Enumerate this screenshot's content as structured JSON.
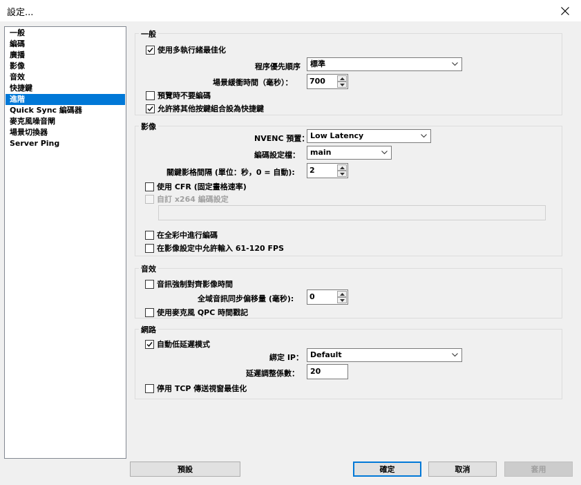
{
  "window": {
    "title": "設定..."
  },
  "sidebar": {
    "items": [
      {
        "label": "一般"
      },
      {
        "label": "編碼"
      },
      {
        "label": "廣播"
      },
      {
        "label": "影像"
      },
      {
        "label": "音效"
      },
      {
        "label": "快捷鍵"
      },
      {
        "label": "進階",
        "selected": true
      },
      {
        "label": "Quick Sync 編碼器"
      },
      {
        "label": "麥克風噪音閘"
      },
      {
        "label": "場景切換器"
      },
      {
        "label": "Server Ping"
      }
    ]
  },
  "general": {
    "title": "一般",
    "multithread_label": "使用多執行緒最佳化",
    "multithread_checked": true,
    "priority_label": "程序優先順序",
    "priority_value": "標準",
    "scene_buffer_label": "場景緩衝時間（毫秒）：",
    "scene_buffer_value": "700",
    "no_encode_preview_label": "預覽時不要編碼",
    "no_encode_preview_checked": false,
    "allow_hotkey_combo_label": "允許將其他按鍵組合設為快捷鍵",
    "allow_hotkey_combo_checked": true
  },
  "video": {
    "title": "影像",
    "nvenc_preset_label": "NVENC 預置：",
    "nvenc_preset_value": "Low Latency",
    "profile_label": "編碼設定檔：",
    "profile_value": "main",
    "keyframe_label": "關鍵影格間隔 (單位：秒，0 = 自動):",
    "keyframe_value": "2",
    "cfr_label": "使用 CFR (固定畫格速率)",
    "cfr_checked": false,
    "custom_x264_label": "自訂 x264 編碼設定",
    "custom_x264_checked": false,
    "custom_x264_value": "",
    "full_range_label": "在全彩中進行編碼",
    "full_range_checked": false,
    "fps_61_120_label": "在影像設定中允許輸入 61-120 FPS",
    "fps_61_120_checked": false
  },
  "audio": {
    "title": "音效",
    "force_sync_label": "音訊強制對齊影像時間",
    "force_sync_checked": false,
    "global_offset_label": "全域音訊同步偏移量 (毫秒):",
    "global_offset_value": "0",
    "mic_qpc_label": "使用麥克風 QPC 時間戳記",
    "mic_qpc_checked": false
  },
  "network": {
    "title": "網路",
    "low_latency_label": "自動低延遲模式",
    "low_latency_checked": true,
    "bind_ip_label": "綁定 IP：",
    "bind_ip_value": "Default",
    "latency_factor_label": "延遲調整係數：",
    "latency_factor_value": "20",
    "disable_tcp_label": "停用 TCP 傳送視窗最佳化",
    "disable_tcp_checked": false
  },
  "buttons": {
    "defaults": "預設",
    "ok": "確定",
    "cancel": "取消",
    "apply": "套用"
  }
}
